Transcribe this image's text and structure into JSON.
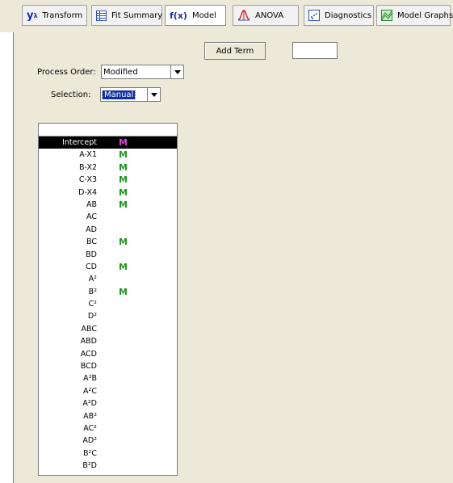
{
  "tabs": [
    {
      "label": "Transform",
      "icon": "y-lambda-icon"
    },
    {
      "label": "Fit Summary",
      "icon": "table-icon"
    },
    {
      "label": "Model",
      "icon": "fx-icon",
      "active": true
    },
    {
      "label": "ANOVA",
      "icon": "anova-curve-icon"
    },
    {
      "label": "Diagnostics",
      "icon": "scatter-icon"
    },
    {
      "label": "Model Graphs",
      "icon": "surface-graph-icon"
    }
  ],
  "add_term_label": "Add Term",
  "term_input_value": "",
  "process_order": {
    "label": "Process Order:",
    "value": "Modified"
  },
  "selection": {
    "label": "Selection:",
    "value": "Manual"
  },
  "model_marker_char": "M",
  "colors": {
    "model_green": "#1a9a1a",
    "model_magenta": "#e040e0",
    "selected_row_bg": "#000000"
  },
  "terms": [
    {
      "name": "Intercept",
      "in_model": true,
      "selected": true
    },
    {
      "name": "A-X1",
      "in_model": true
    },
    {
      "name": "B-X2",
      "in_model": true
    },
    {
      "name": "C-X3",
      "in_model": true
    },
    {
      "name": "D-X4",
      "in_model": true
    },
    {
      "name": "AB",
      "in_model": true
    },
    {
      "name": "AC",
      "in_model": false
    },
    {
      "name": "AD",
      "in_model": false
    },
    {
      "name": "BC",
      "in_model": true
    },
    {
      "name": "BD",
      "in_model": false
    },
    {
      "name": "CD",
      "in_model": true
    },
    {
      "name": "A²",
      "in_model": false
    },
    {
      "name": "B²",
      "in_model": true
    },
    {
      "name": "C²",
      "in_model": false
    },
    {
      "name": "D²",
      "in_model": false
    },
    {
      "name": "ABC",
      "in_model": false
    },
    {
      "name": "ABD",
      "in_model": false
    },
    {
      "name": "ACD",
      "in_model": false
    },
    {
      "name": "BCD",
      "in_model": false
    },
    {
      "name": "A²B",
      "in_model": false
    },
    {
      "name": "A²C",
      "in_model": false
    },
    {
      "name": "A²D",
      "in_model": false
    },
    {
      "name": "AB²",
      "in_model": false
    },
    {
      "name": "AC²",
      "in_model": false
    },
    {
      "name": "AD²",
      "in_model": false
    },
    {
      "name": "B²C",
      "in_model": false
    },
    {
      "name": "B²D",
      "in_model": false
    }
  ]
}
